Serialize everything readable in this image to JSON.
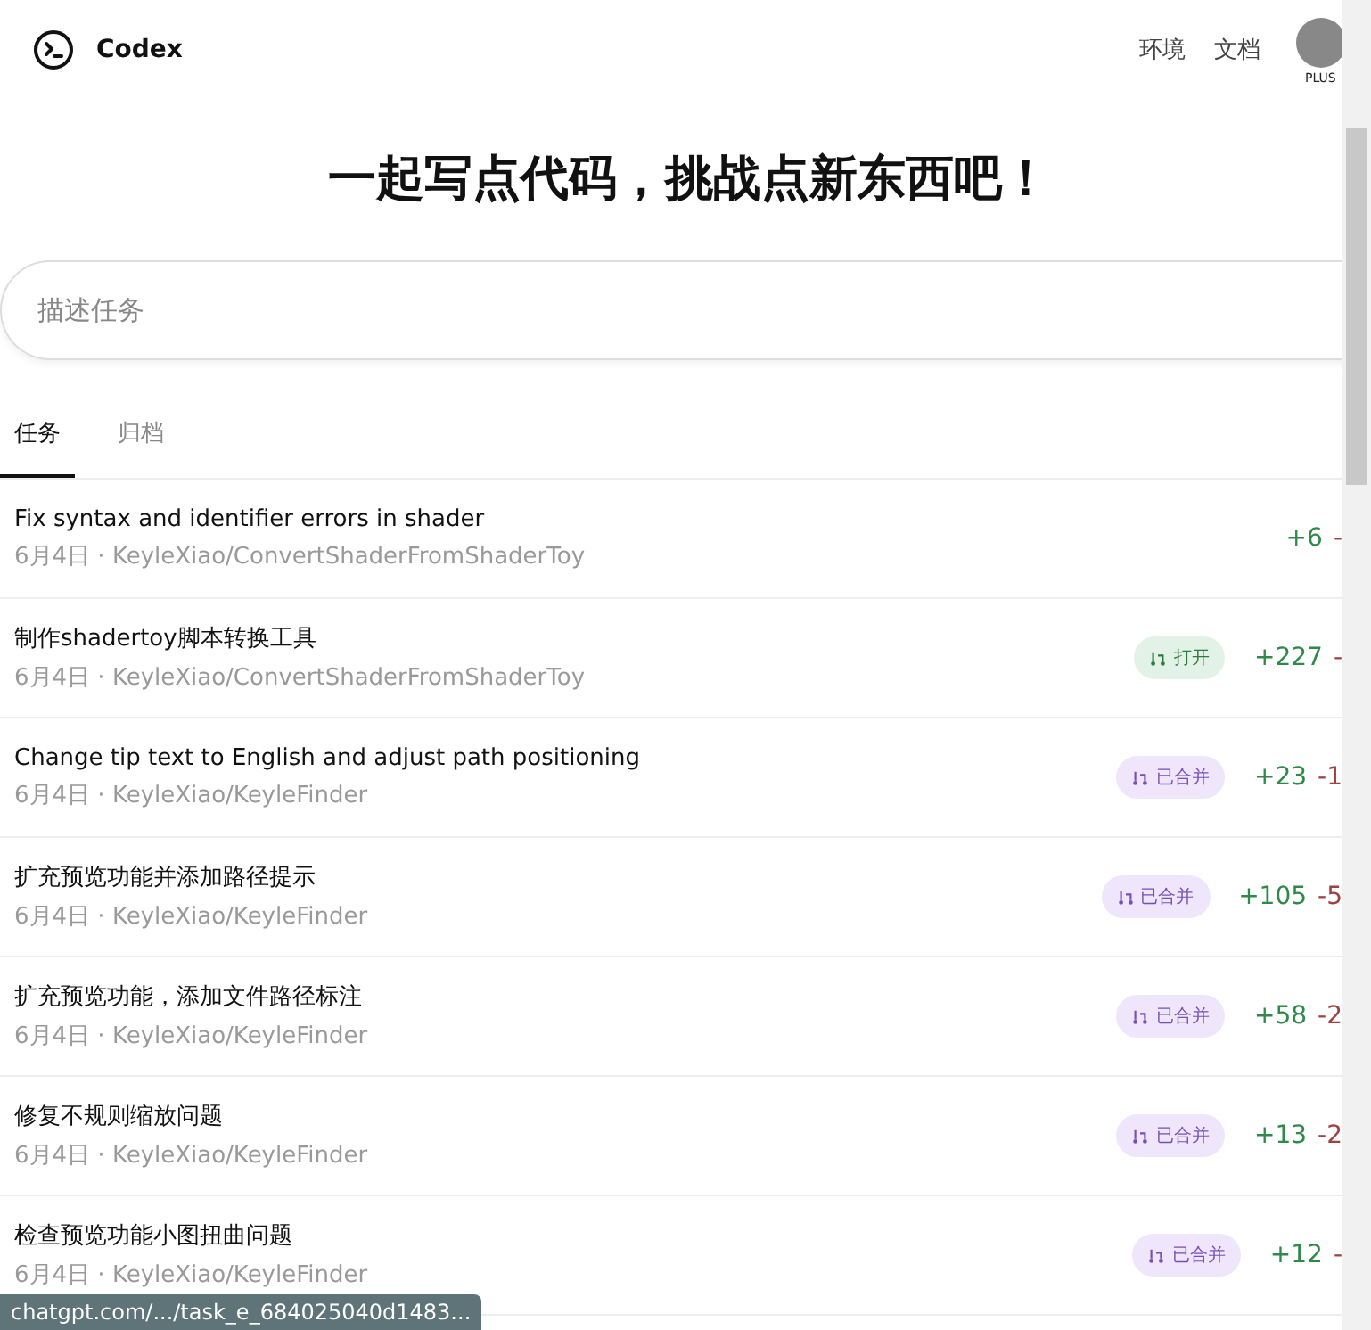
{
  "header": {
    "brand": "Codex",
    "nav": [
      "环境",
      "文档"
    ],
    "avatar_badge": "PLUS"
  },
  "hero": {
    "title": "一起写点代码，挑战点新东西吧！"
  },
  "search": {
    "placeholder": "描述任务"
  },
  "tabs": [
    {
      "label": "任务",
      "selected": true
    },
    {
      "label": "归档",
      "selected": false
    }
  ],
  "tasks": [
    {
      "title": "Fix syntax and identifier errors in shader",
      "meta": "6月4日 · KeyleXiao/ConvertShaderFromShaderToy",
      "added": "+6",
      "removed": "-"
    },
    {
      "title": "制作shadertoy脚本转换工具",
      "meta": "6月4日 · KeyleXiao/ConvertShaderFromShaderToy",
      "pr": {
        "kind": "open",
        "label": "打开"
      },
      "added": "+227",
      "removed": "-"
    },
    {
      "title": "Change tip text to English and adjust path positioning",
      "meta": "6月4日 · KeyleXiao/KeyleFinder",
      "pr": {
        "kind": "merged",
        "label": "已合并"
      },
      "added": "+23",
      "removed": "-1"
    },
    {
      "title": "扩充预览功能并添加路径提示",
      "meta": "6月4日 · KeyleXiao/KeyleFinder",
      "pr": {
        "kind": "merged",
        "label": "已合并"
      },
      "added": "+105",
      "removed": "-5"
    },
    {
      "title": "扩充预览功能，添加文件路径标注",
      "meta": "6月4日 · KeyleXiao/KeyleFinder",
      "pr": {
        "kind": "merged",
        "label": "已合并"
      },
      "added": "+58",
      "removed": "-2"
    },
    {
      "title": "修复不规则缩放问题",
      "meta": "6月4日 · KeyleXiao/KeyleFinder",
      "pr": {
        "kind": "merged",
        "label": "已合并"
      },
      "added": "+13",
      "removed": "-2"
    },
    {
      "title": "检查预览功能小图扭曲问题",
      "meta": "6月4日 · KeyleXiao/KeyleFinder",
      "pr": {
        "kind": "merged",
        "label": "已合并"
      },
      "added": "+12",
      "removed": "-"
    }
  ],
  "status_url": "chatgpt.com/.../task_e_684025040d1483..."
}
